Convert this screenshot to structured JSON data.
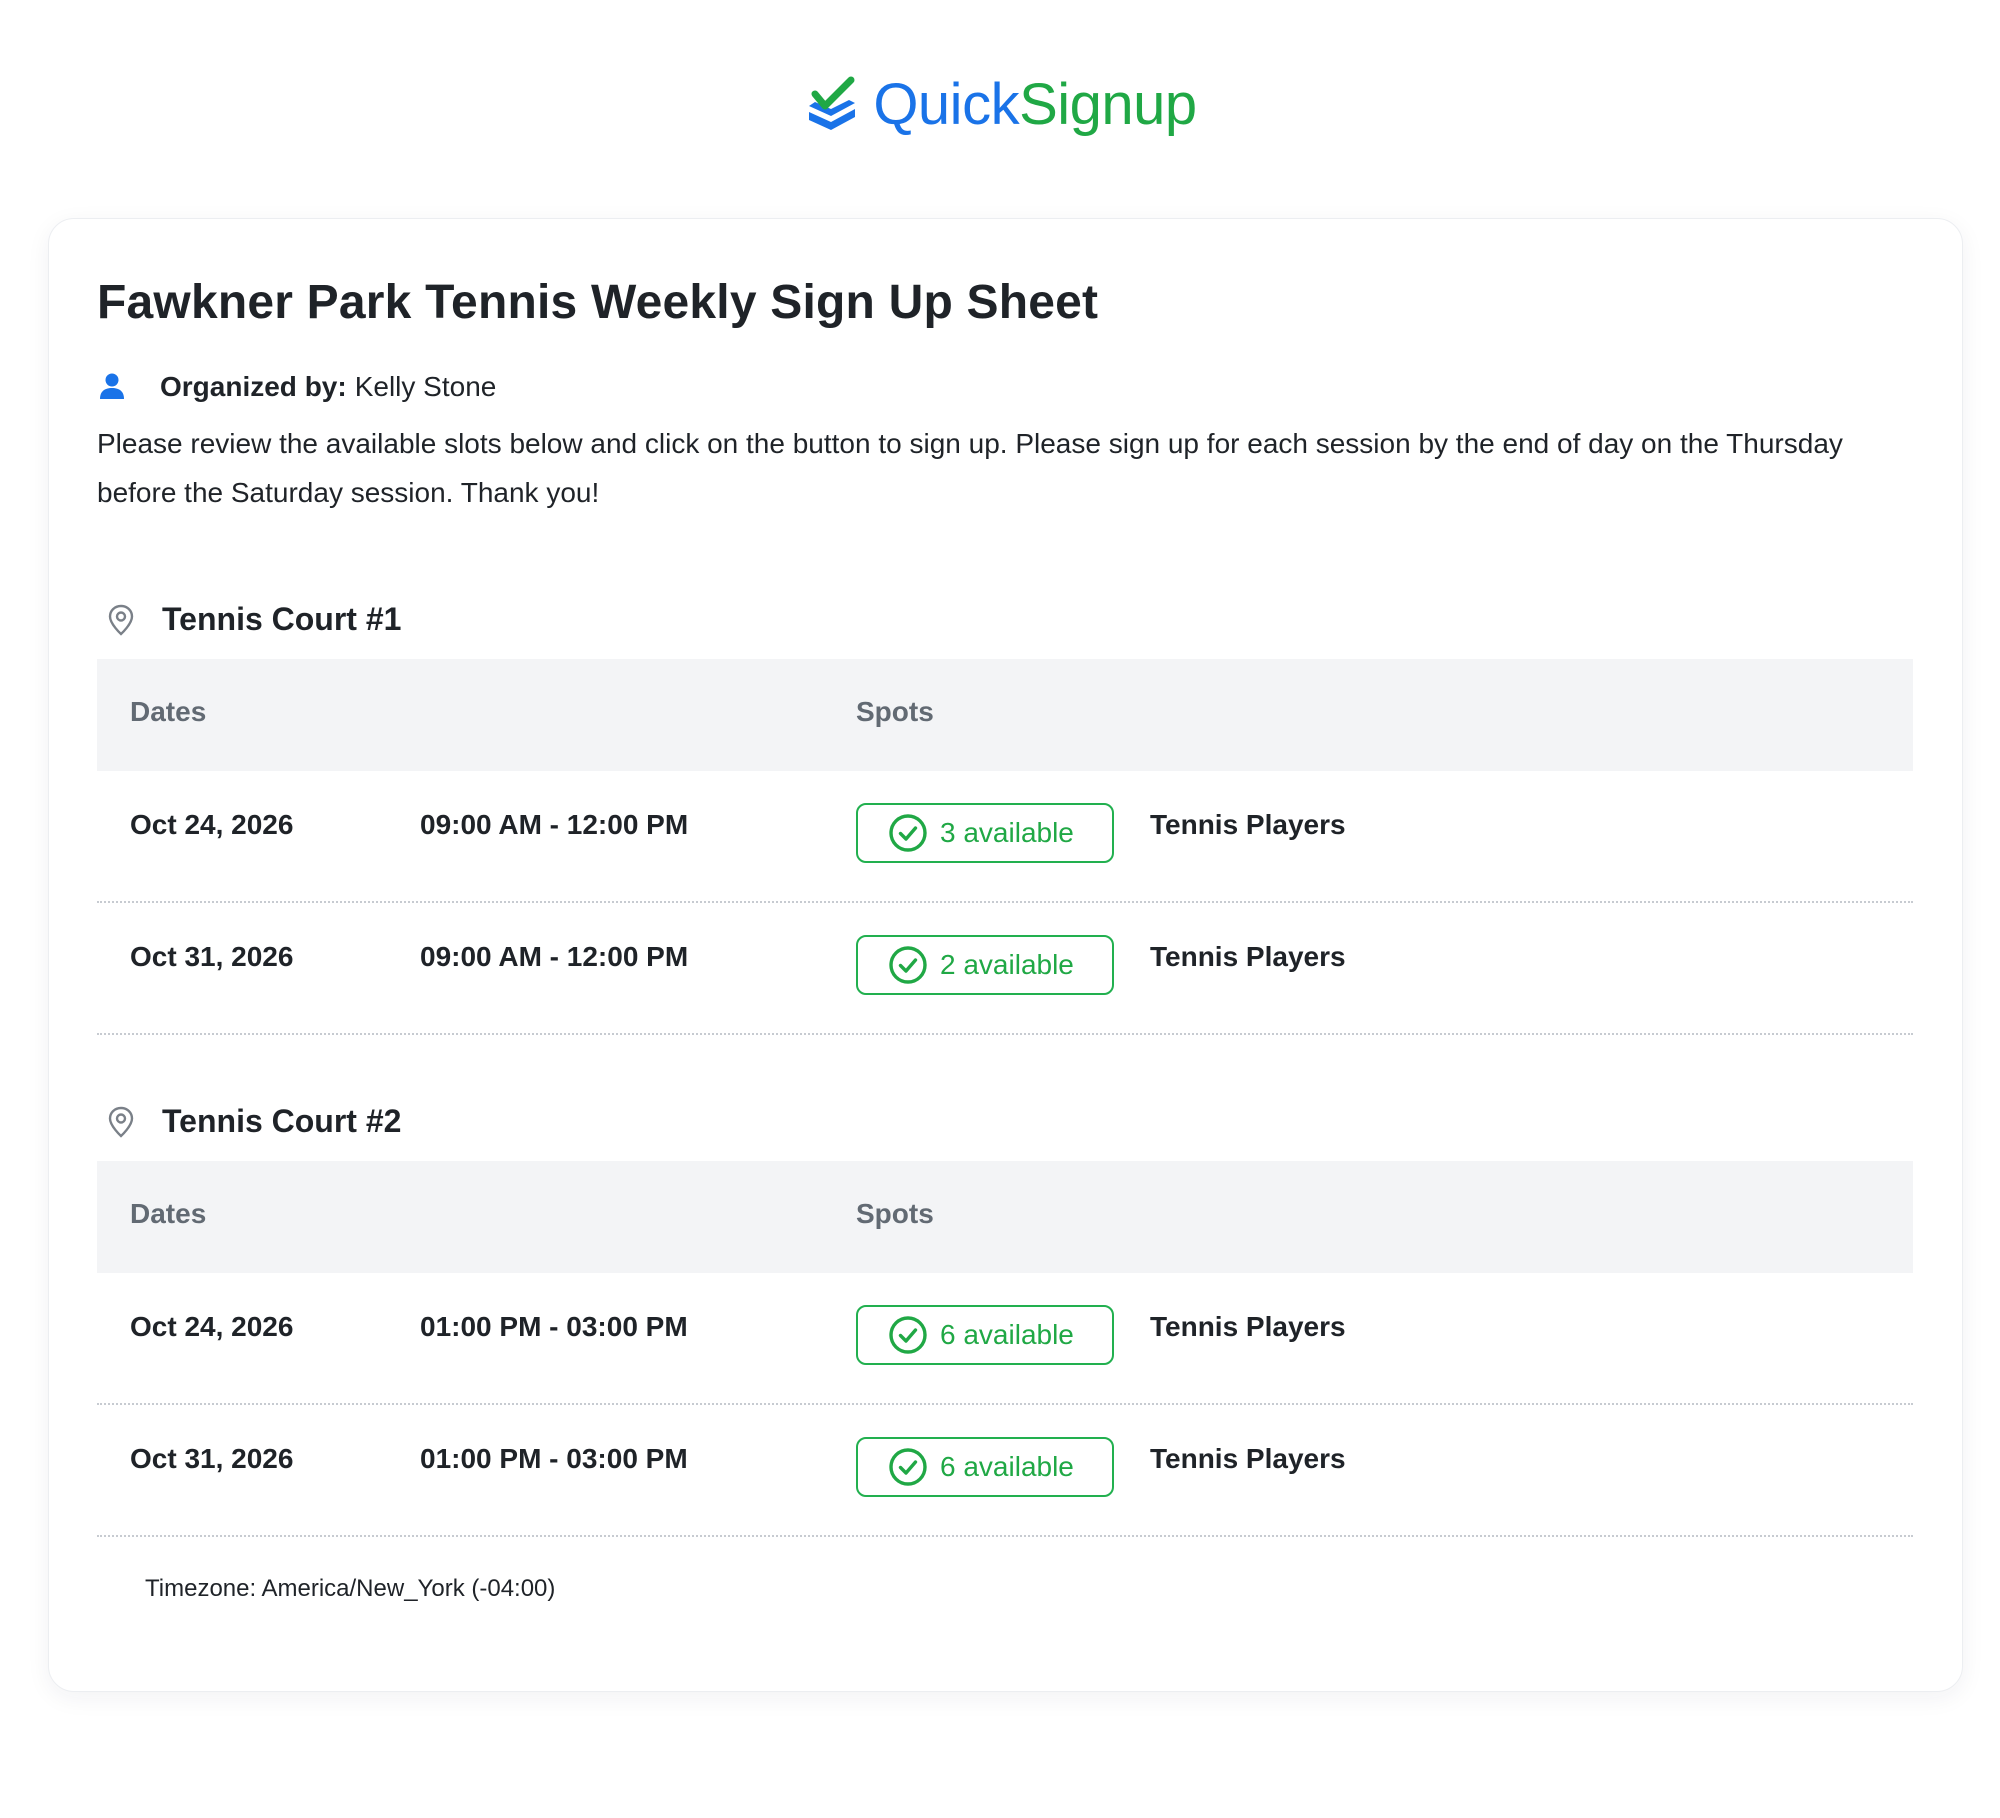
{
  "brand": {
    "name_part1": "Quick",
    "name_part2": "Signup"
  },
  "colors": {
    "brand_blue": "#1a73e8",
    "brand_green": "#20a845",
    "badge_border": "#22b04f",
    "header_bg": "#f3f4f6"
  },
  "sheet": {
    "title": "Fawkner Park Tennis Weekly Sign Up Sheet",
    "organizer_label": "Organized by:",
    "organizer_name": "Kelly Stone",
    "description": "Please review the available slots below and click on the button to sign up. Please sign up for each session by the end of day on the Thursday before the Saturday session. Thank you!"
  },
  "sections": [
    {
      "title": "Tennis Court #1",
      "headers": {
        "dates": "Dates",
        "spots": "Spots"
      },
      "slots": [
        {
          "date": "Oct 24, 2026",
          "time": "09:00 AM - 12:00 PM",
          "available": "3 available",
          "role": "Tennis Players"
        },
        {
          "date": "Oct 31, 2026",
          "time": "09:00 AM - 12:00 PM",
          "available": "2 available",
          "role": "Tennis Players"
        }
      ]
    },
    {
      "title": "Tennis Court #2",
      "headers": {
        "dates": "Dates",
        "spots": "Spots"
      },
      "slots": [
        {
          "date": "Oct 24, 2026",
          "time": "01:00 PM - 03:00 PM",
          "available": "6 available",
          "role": "Tennis Players"
        },
        {
          "date": "Oct 31, 2026",
          "time": "01:00 PM - 03:00 PM",
          "available": "6 available",
          "role": "Tennis Players"
        }
      ]
    }
  ],
  "timezone": "Timezone: America/New_York (-04:00)"
}
